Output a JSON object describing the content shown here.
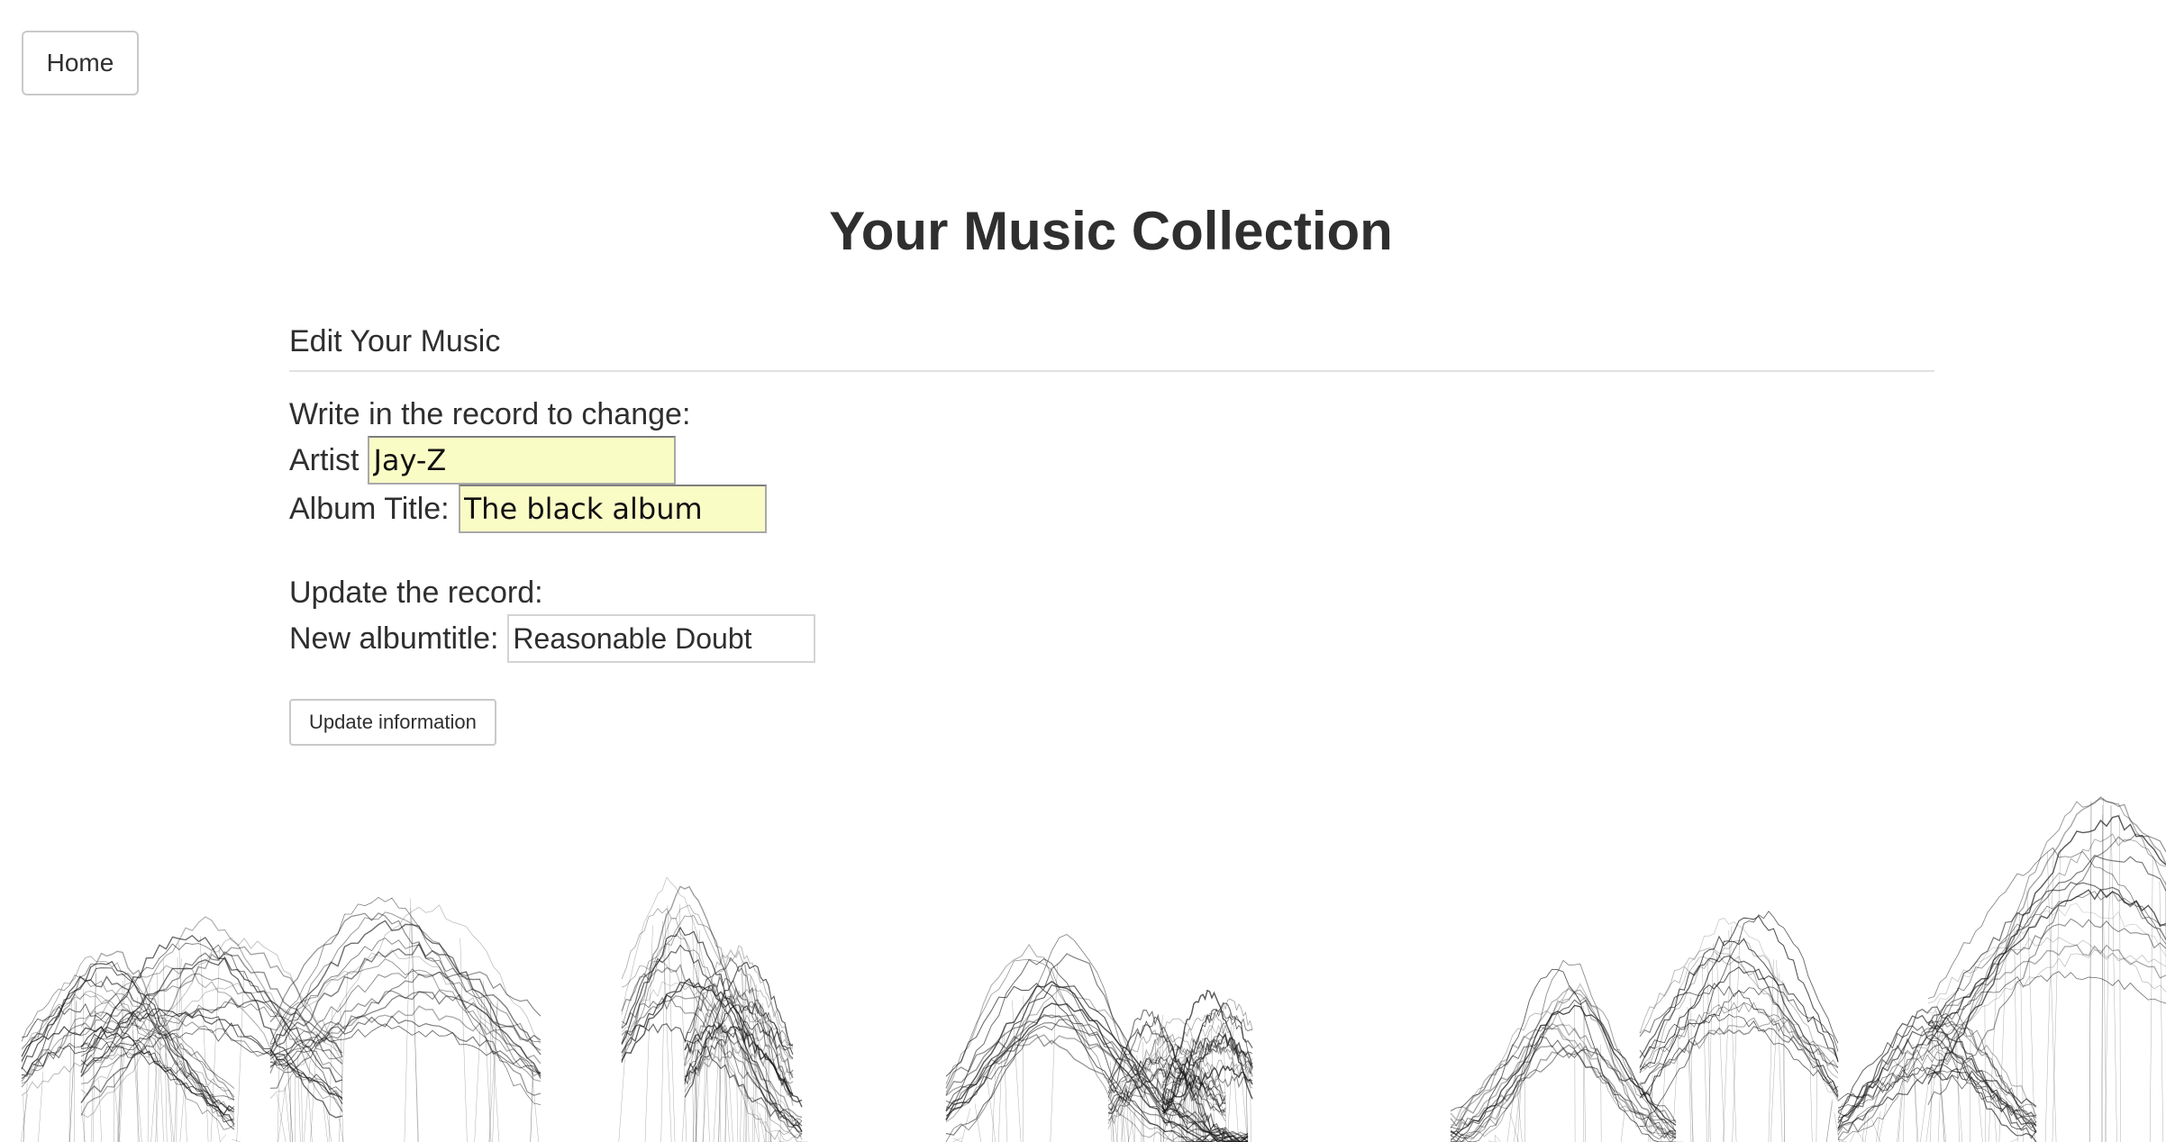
{
  "nav": {
    "home_label": "Home"
  },
  "page_title": "Your Music Collection",
  "section": {
    "heading": "Edit Your Music"
  },
  "form": {
    "change_note": "Write in the record to change:",
    "artist_label": "Artist",
    "artist_value": "Jay-Z",
    "album_label": "Album Title:",
    "album_value": "The black album",
    "update_note": "Update the record:",
    "new_title_label": "New albumtitle:",
    "new_title_value": "Reasonable Doubt",
    "submit_label": "Update information"
  },
  "colors": {
    "text": "#2f2f2f",
    "autofill_background": "#fafcc6",
    "border": "#c9c9c9",
    "mountain_stroke": "#1a1a1a"
  }
}
